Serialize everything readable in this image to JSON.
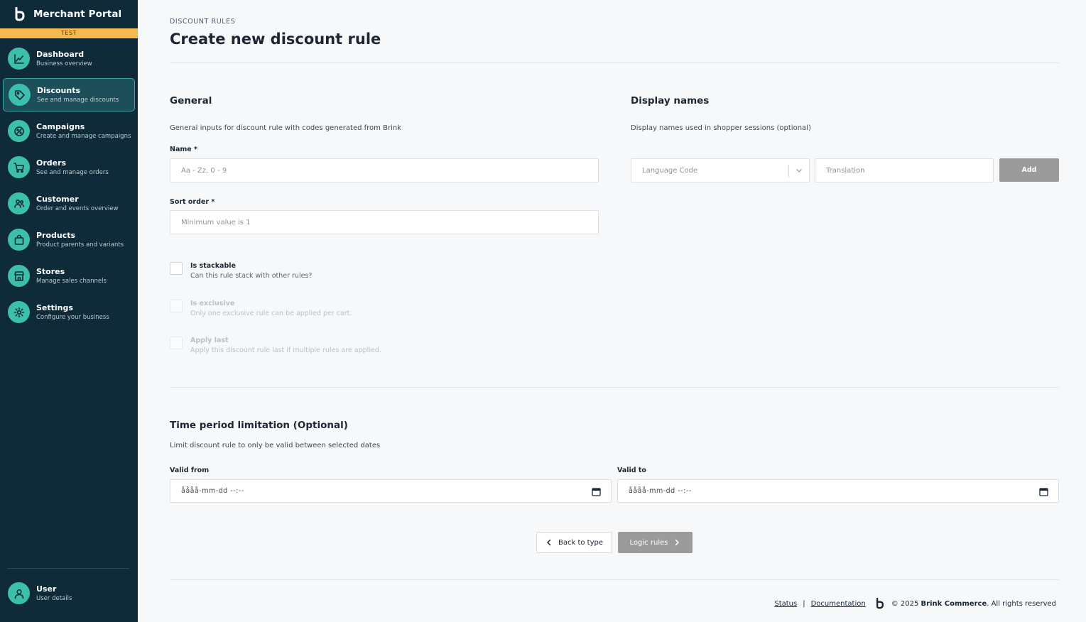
{
  "brand": {
    "title": "Merchant Portal",
    "env": "TEST"
  },
  "nav": [
    {
      "id": "dashboard",
      "title": "Dashboard",
      "sub": "Business overview",
      "icon": "chart-line-icon",
      "active": false
    },
    {
      "id": "discounts",
      "title": "Discounts",
      "sub": "See and manage discounts",
      "icon": "tag-icon",
      "active": true
    },
    {
      "id": "campaigns",
      "title": "Campaigns",
      "sub": "Create and manage campaigns",
      "icon": "campaign-icon",
      "active": false
    },
    {
      "id": "orders",
      "title": "Orders",
      "sub": "See and manage orders",
      "icon": "cart-icon",
      "active": false
    },
    {
      "id": "customer",
      "title": "Customer",
      "sub": "Order and events overview",
      "icon": "people-icon",
      "active": false
    },
    {
      "id": "products",
      "title": "Products",
      "sub": "Product parents and variants",
      "icon": "bag-icon",
      "active": false
    },
    {
      "id": "stores",
      "title": "Stores",
      "sub": "Manage sales channels",
      "icon": "store-icon",
      "active": false
    },
    {
      "id": "settings",
      "title": "Settings",
      "sub": "Configure your business",
      "icon": "gear-icon",
      "active": false
    }
  ],
  "user": {
    "title": "User",
    "sub": "User details"
  },
  "header": {
    "overline": "DISCOUNT RULES",
    "title": "Create new discount rule"
  },
  "general": {
    "title": "General",
    "desc": "General inputs for discount rule with codes generated from Brink",
    "name_label": "Name *",
    "name_placeholder": "Aa - Zz, 0 - 9",
    "sort_label": "Sort order *",
    "sort_placeholder": "Minimum value is 1",
    "checks": [
      {
        "title": "Is stackable",
        "sub": "Can this rule stack with other rules?",
        "disabled": false
      },
      {
        "title": "Is exclusive",
        "sub": "Only one exclusive rule can be applied per cart.",
        "disabled": true
      },
      {
        "title": "Apply last",
        "sub": "Apply this discount rule last if multiple rules are applied.",
        "disabled": true
      }
    ]
  },
  "display_names": {
    "title": "Display names",
    "desc": "Display names used in shopper sessions (optional)",
    "language_placeholder": "Language Code",
    "translation_placeholder": "Translation",
    "add_label": "Add"
  },
  "time_period": {
    "title": "Time period limitation (Optional)",
    "desc": "Limit discount rule to only be valid between selected dates",
    "from_label": "Valid from",
    "to_label": "Valid to",
    "from_value": "åååå-mm-dd --:--",
    "to_value": "åååå-mm-dd --:--"
  },
  "actions": {
    "back_label": "Back to type",
    "next_label": "Logic rules"
  },
  "footer": {
    "status": "Status",
    "separator": "|",
    "documentation": "Documentation",
    "copyright_prefix": "© 2025",
    "company": "Brink Commerce",
    "copyright_suffix": ". All rights reserved"
  }
}
